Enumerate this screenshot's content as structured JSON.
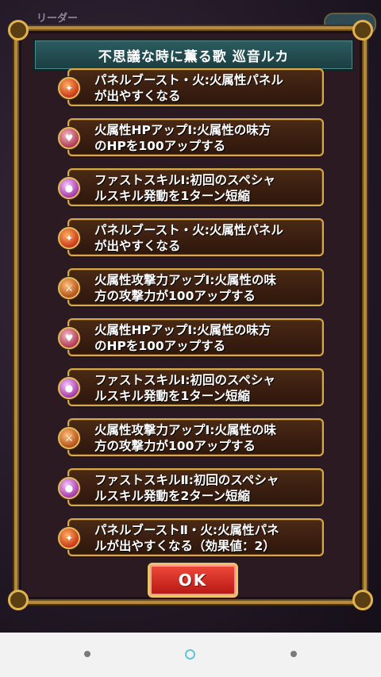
{
  "background": {
    "leader_label": "リーダー"
  },
  "dialog": {
    "title": "不思議な時に薫る歌 巡音ルカ",
    "ok_label": "OK"
  },
  "skills": [
    {
      "icon": "fire-panel-icon",
      "text": "パネルブースト・火:火属性パネル\nが出やすくなる"
    },
    {
      "icon": "heart-hp-icon",
      "text": "火属性HPアップⅠ:火属性の味方\nのHPを100アップする"
    },
    {
      "icon": "orb-skill-icon",
      "text": "ファストスキルⅠ:初回のスペシャ\nルスキル発動を1ターン短縮"
    },
    {
      "icon": "fire-panel-icon",
      "text": "パネルブースト・火:火属性パネル\nが出やすくなる"
    },
    {
      "icon": "slash-attack-icon",
      "text": "火属性攻撃力アップⅠ:火属性の味\n方の攻撃力が100アップする"
    },
    {
      "icon": "heart-hp-icon",
      "text": "火属性HPアップⅠ:火属性の味方\nのHPを100アップする"
    },
    {
      "icon": "orb-skill-icon",
      "text": "ファストスキルⅠ:初回のスペシャ\nルスキル発動を1ターン短縮"
    },
    {
      "icon": "slash-attack-icon",
      "text": "火属性攻撃力アップⅠ:火属性の味\n方の攻撃力が100アップする"
    },
    {
      "icon": "orb-skill-icon",
      "text": "ファストスキルⅡ:初回のスペシャ\nルスキル発動を2ターン短縮"
    },
    {
      "icon": "fire-panel-icon",
      "text": "パネルブーストⅡ・火:火属性パネ\nルが出やすくなる（効果値：2）"
    }
  ],
  "colors": {
    "frame_gold": "#d6aa4a",
    "title_teal": "#2c5d60",
    "ok_red": "#d8281e"
  }
}
